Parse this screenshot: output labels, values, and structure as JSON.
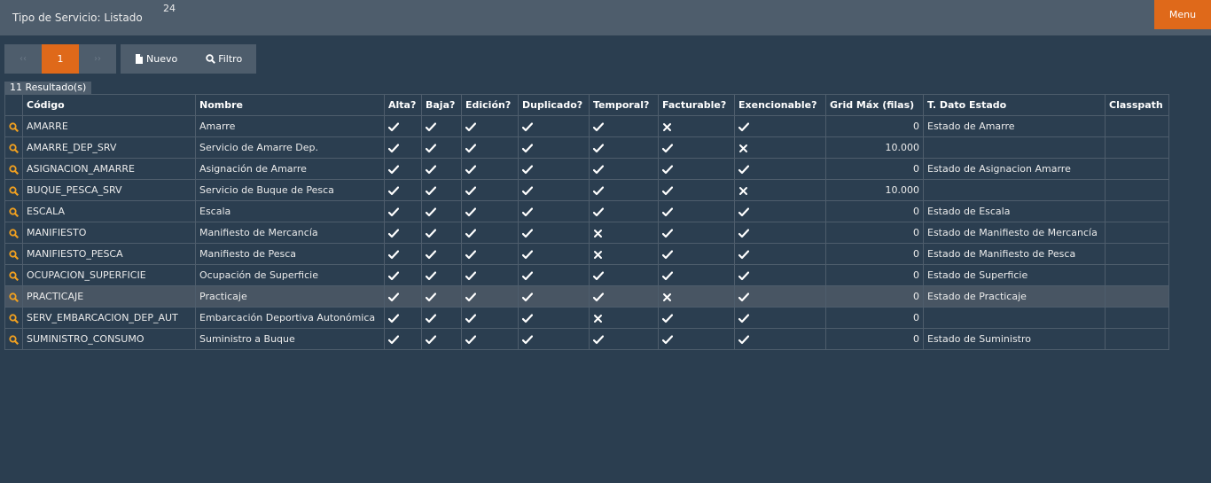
{
  "header": {
    "title": "Tipo de Servicio: Listado",
    "count": "24",
    "menu_label": "Menu"
  },
  "pager": {
    "prev_label": "‹‹",
    "current": "1",
    "next_label": "››"
  },
  "actions": {
    "new_label": "Nuevo",
    "filter_label": "Filtro"
  },
  "results_label": "11 Resultado(s)",
  "table": {
    "columns": [
      "Código",
      "Nombre",
      "Alta?",
      "Baja?",
      "Edición?",
      "Duplicado?",
      "Temporal?",
      "Facturable?",
      "Exencionable?",
      "Grid Máx (filas)",
      "T. Dato Estado",
      "Classpath"
    ],
    "rows": [
      {
        "codigo": "AMARRE",
        "nombre": "Amarre",
        "alta": true,
        "baja": true,
        "edicion": true,
        "duplicado": true,
        "temporal": true,
        "facturable": false,
        "exencionable": true,
        "grid": "0",
        "estado": "Estado de Amarre",
        "classpath": ""
      },
      {
        "codigo": "AMARRE_DEP_SRV",
        "nombre": "Servicio de Amarre Dep.",
        "alta": true,
        "baja": true,
        "edicion": true,
        "duplicado": true,
        "temporal": true,
        "facturable": true,
        "exencionable": false,
        "grid": "10.000",
        "estado": "",
        "classpath": ""
      },
      {
        "codigo": "ASIGNACION_AMARRE",
        "nombre": "Asignación de Amarre",
        "alta": true,
        "baja": true,
        "edicion": true,
        "duplicado": true,
        "temporal": true,
        "facturable": true,
        "exencionable": true,
        "grid": "0",
        "estado": "Estado de Asignacion Amarre",
        "classpath": ""
      },
      {
        "codigo": "BUQUE_PESCA_SRV",
        "nombre": "Servicio de Buque de Pesca",
        "alta": true,
        "baja": true,
        "edicion": true,
        "duplicado": true,
        "temporal": true,
        "facturable": true,
        "exencionable": false,
        "grid": "10.000",
        "estado": "",
        "classpath": ""
      },
      {
        "codigo": "ESCALA",
        "nombre": "Escala",
        "alta": true,
        "baja": true,
        "edicion": true,
        "duplicado": true,
        "temporal": true,
        "facturable": true,
        "exencionable": true,
        "grid": "0",
        "estado": "Estado de Escala",
        "classpath": ""
      },
      {
        "codigo": "MANIFIESTO",
        "nombre": "Manifiesto de Mercancía",
        "alta": true,
        "baja": true,
        "edicion": true,
        "duplicado": true,
        "temporal": false,
        "facturable": true,
        "exencionable": true,
        "grid": "0",
        "estado": "Estado de Manifiesto de Mercancía",
        "classpath": ""
      },
      {
        "codigo": "MANIFIESTO_PESCA",
        "nombre": "Manifiesto de Pesca",
        "alta": true,
        "baja": true,
        "edicion": true,
        "duplicado": true,
        "temporal": false,
        "facturable": true,
        "exencionable": true,
        "grid": "0",
        "estado": "Estado de Manifiesto de Pesca",
        "classpath": ""
      },
      {
        "codigo": "OCUPACION_SUPERFICIE",
        "nombre": "Ocupación de Superficie",
        "alta": true,
        "baja": true,
        "edicion": true,
        "duplicado": true,
        "temporal": true,
        "facturable": true,
        "exencionable": true,
        "grid": "0",
        "estado": "Estado de Superficie",
        "classpath": ""
      },
      {
        "codigo": "PRACTICAJE",
        "nombre": "Practicaje",
        "alta": true,
        "baja": true,
        "edicion": true,
        "duplicado": true,
        "temporal": true,
        "facturable": false,
        "exencionable": true,
        "grid": "0",
        "estado": "Estado de Practicaje",
        "classpath": "",
        "highlighted": true
      },
      {
        "codigo": "SERV_EMBARCACION_DEP_AUT",
        "nombre": "Embarcación Deportiva Autonómica",
        "alta": true,
        "baja": true,
        "edicion": true,
        "duplicado": true,
        "temporal": false,
        "facturable": true,
        "exencionable": true,
        "grid": "0",
        "estado": "",
        "classpath": ""
      },
      {
        "codigo": "SUMINISTRO_CONSUMO",
        "nombre": "Suministro a Buque",
        "alta": true,
        "baja": true,
        "edicion": true,
        "duplicado": true,
        "temporal": true,
        "facturable": true,
        "exencionable": true,
        "grid": "0",
        "estado": "Estado de Suministro",
        "classpath": ""
      }
    ]
  },
  "colors": {
    "background": "#2b3e50",
    "panel": "#4e5d6c",
    "accent": "#df691a",
    "highlight_row": "#485563",
    "search_icon": "#f0a020"
  },
  "icons": {
    "row_action": "search-icon",
    "true_mark": "check-icon",
    "false_mark": "cross-icon",
    "new": "file-icon",
    "filter": "search-icon"
  }
}
